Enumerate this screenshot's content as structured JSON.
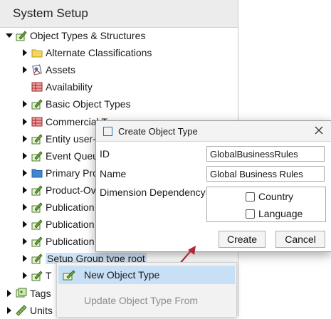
{
  "panel": {
    "title": "System Setup",
    "tree": [
      {
        "label": "Object Types & Structures",
        "icon": "pencil-icon",
        "expander": "expanded"
      },
      {
        "label": "Alternate Classifications",
        "icon": "folder-icon",
        "expander": "collapsed"
      },
      {
        "label": "Assets",
        "icon": "asset-icon",
        "expander": "collapsed"
      },
      {
        "label": "Availability",
        "icon": "table-icon",
        "expander": "none"
      },
      {
        "label": "Basic Object Types",
        "icon": "pencil-icon",
        "expander": "collapsed"
      },
      {
        "label": "Commercial T",
        "icon": "table-icon",
        "expander": "collapsed"
      },
      {
        "label": "Entity user-",
        "icon": "pencil-icon",
        "expander": "collapsed"
      },
      {
        "label": "Event Queu",
        "icon": "pencil-icon",
        "expander": "collapsed"
      },
      {
        "label": "Primary Pro",
        "icon": "blue-folder-icon",
        "expander": "collapsed"
      },
      {
        "label": "Product-Ov",
        "icon": "pencil-icon",
        "expander": "collapsed"
      },
      {
        "label": "Publication",
        "icon": "pencil-icon",
        "expander": "collapsed"
      },
      {
        "label": "Publication",
        "icon": "pencil-icon",
        "expander": "collapsed"
      },
      {
        "label": "Publication",
        "icon": "pencil-icon",
        "expander": "collapsed"
      },
      {
        "label": "Setup Group type root",
        "icon": "pencil-icon",
        "expander": "collapsed",
        "selected": true
      },
      {
        "label": "T",
        "icon": "pencil-icon",
        "expander": "collapsed"
      },
      {
        "label": "Tags",
        "icon": "tags-icon",
        "expander": "collapsed"
      },
      {
        "label": "Units",
        "icon": "ruler-icon",
        "expander": "collapsed"
      }
    ]
  },
  "dialog": {
    "title": "Create Object Type",
    "id_label": "ID",
    "id_value": "GlobalBusinessRules",
    "name_label": "Name",
    "name_value": "Global Business Rules",
    "dimension_label": "Dimension Dependency",
    "dimensions": [
      {
        "label": "Country",
        "checked": false
      },
      {
        "label": "Language",
        "checked": false
      }
    ],
    "create_label": "Create",
    "cancel_label": "Cancel"
  },
  "context_menu": {
    "items": [
      {
        "label": "New Object Type",
        "icon": "pencil-icon",
        "highlighted": true,
        "enabled": true
      },
      {
        "label": "Update Object Type From",
        "icon": "",
        "highlighted": false,
        "enabled": false
      }
    ]
  },
  "colors": {
    "selection": "#cfe3f7",
    "menu_highlight": "#c8e0f6",
    "arrow": "#b0283c",
    "accent": "#1f6fb5"
  }
}
